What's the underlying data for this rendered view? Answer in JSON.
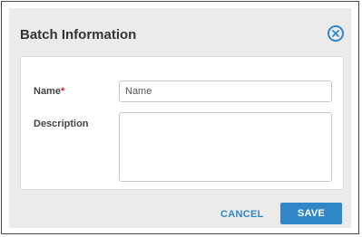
{
  "dialog": {
    "title": "Batch Information",
    "close_icon": "close-circle-icon"
  },
  "form": {
    "name": {
      "label": "Name",
      "required_marker": "*",
      "placeholder": "Name",
      "value": ""
    },
    "description": {
      "label": "Description",
      "value": ""
    }
  },
  "actions": {
    "cancel_label": "CANCEL",
    "save_label": "SAVE"
  },
  "colors": {
    "accent": "#2f87c7",
    "required": "#cc2222",
    "dialog_background": "#ebebeb"
  }
}
